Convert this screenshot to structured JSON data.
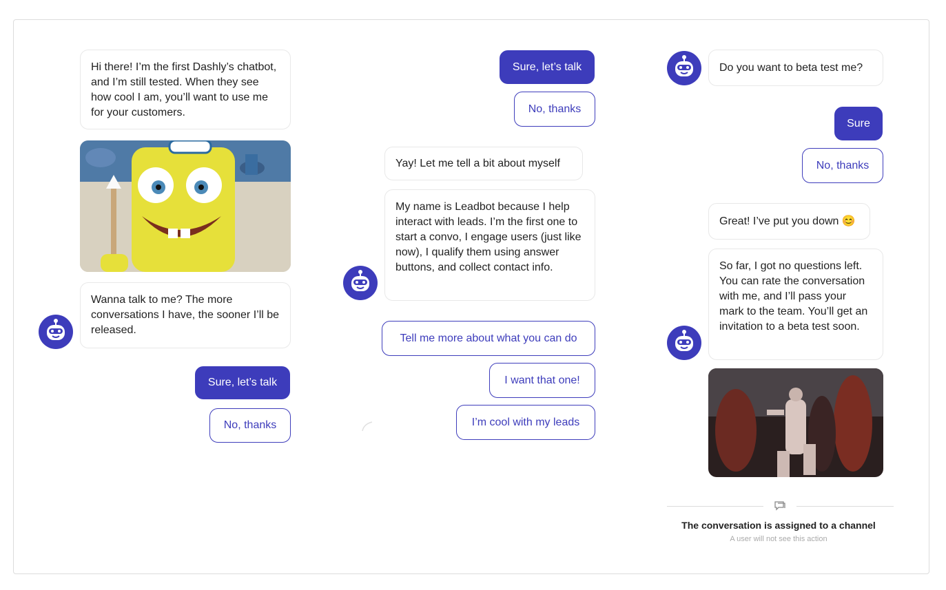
{
  "column1": {
    "intro_message": "Hi there! I’m the first Dashly’s chatbot, and I’m still tested. When they see how cool I am, you’ll want to use me for your customers.",
    "gif_description_icon": "spongebob-gif",
    "question_message": "Wanna talk to me? The more conversations I have, the sooner I’ll be released.",
    "button_yes": "Sure, let’s talk",
    "button_no": "No, thanks"
  },
  "column2": {
    "button_yes": "Sure, let’s talk",
    "button_no": "No, thanks",
    "message_1": "Yay! Let me tell a bit about myself",
    "message_2": "My name is Leadbot because I help interact with leads. I’m the first one to start a convo, I engage users (just like now), I qualify them using answer buttons, and collect contact info.",
    "option_1": "Tell me more about what you can do",
    "option_2": "I want that one!",
    "option_3": "I’m cool with my leads"
  },
  "column3": {
    "question_message": "Do you want to beta test me?",
    "button_yes": "Sure",
    "button_no": "No, thanks",
    "confirm_message": "Great! I’ve put you down 😊",
    "final_message": "So far, I got no questions left. You can rate the conversation with me, and I’ll pass your mark to the team. You’ll get an invitation to a beta test soon.",
    "system_title": "The conversation is assigned to a channel",
    "system_subtitle": "A user will not see this action"
  },
  "colors": {
    "accent": "#3d3cbb",
    "bubble_border": "#e8e8e8",
    "frame_border": "#dcdcdc"
  },
  "icons": {
    "avatar": "robot-avatar-icon",
    "system": "chat-bubbles-icon"
  }
}
